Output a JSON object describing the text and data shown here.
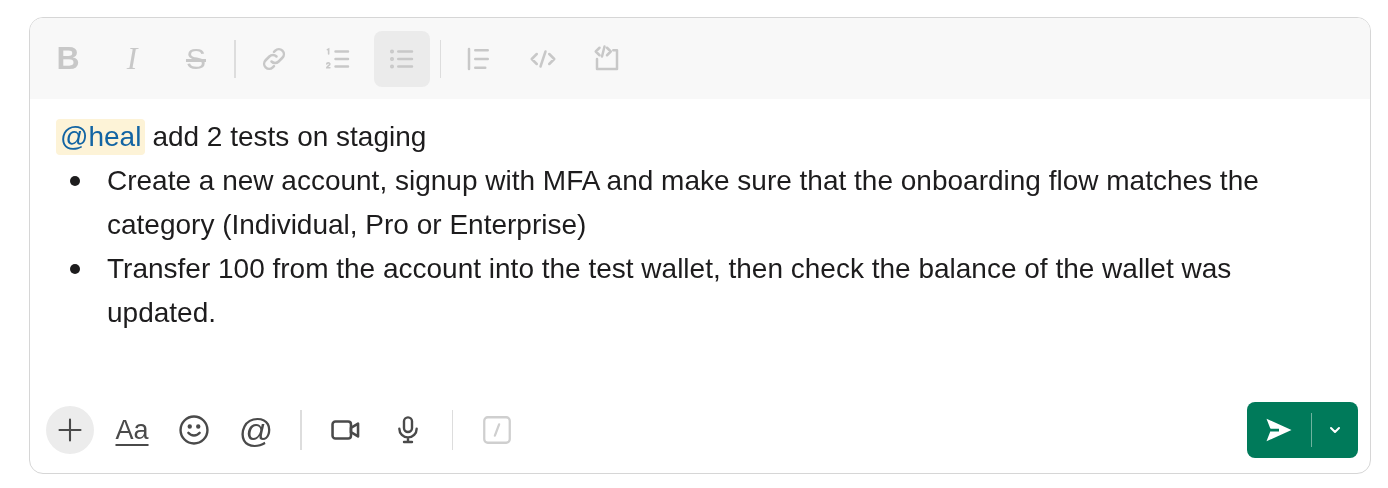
{
  "format_toolbar": {
    "disabled": true,
    "tools": [
      {
        "kind": "bold",
        "label": "B",
        "selected": false
      },
      {
        "kind": "italic",
        "label": "I",
        "selected": false
      },
      {
        "kind": "strike",
        "label": "S",
        "selected": false
      },
      {
        "kind": "divider"
      },
      {
        "kind": "link",
        "selected": false
      },
      {
        "kind": "ordered-list",
        "selected": false
      },
      {
        "kind": "bullet-list",
        "selected": true
      },
      {
        "kind": "divider"
      },
      {
        "kind": "quote",
        "selected": false
      },
      {
        "kind": "code",
        "selected": false
      },
      {
        "kind": "code-block",
        "selected": false
      }
    ]
  },
  "message": {
    "mention": "@heal",
    "text": "add 2 tests on staging",
    "bullets": [
      "Create a new account, signup with MFA and make sure that the onboarding flow matches the category (Individual, Pro or Enterprise)",
      "Transfer 100 from the account into the test wallet, then check the balance of the wallet was updated."
    ]
  },
  "bottom_toolbar": {
    "tools": [
      {
        "kind": "plus"
      },
      {
        "kind": "format",
        "label": "Aa"
      },
      {
        "kind": "emoji"
      },
      {
        "kind": "mention",
        "label": "@"
      },
      {
        "kind": "divider"
      },
      {
        "kind": "video"
      },
      {
        "kind": "mic"
      },
      {
        "kind": "divider"
      },
      {
        "kind": "slash",
        "disabled": true
      }
    ]
  },
  "send": {
    "disabled": false
  }
}
